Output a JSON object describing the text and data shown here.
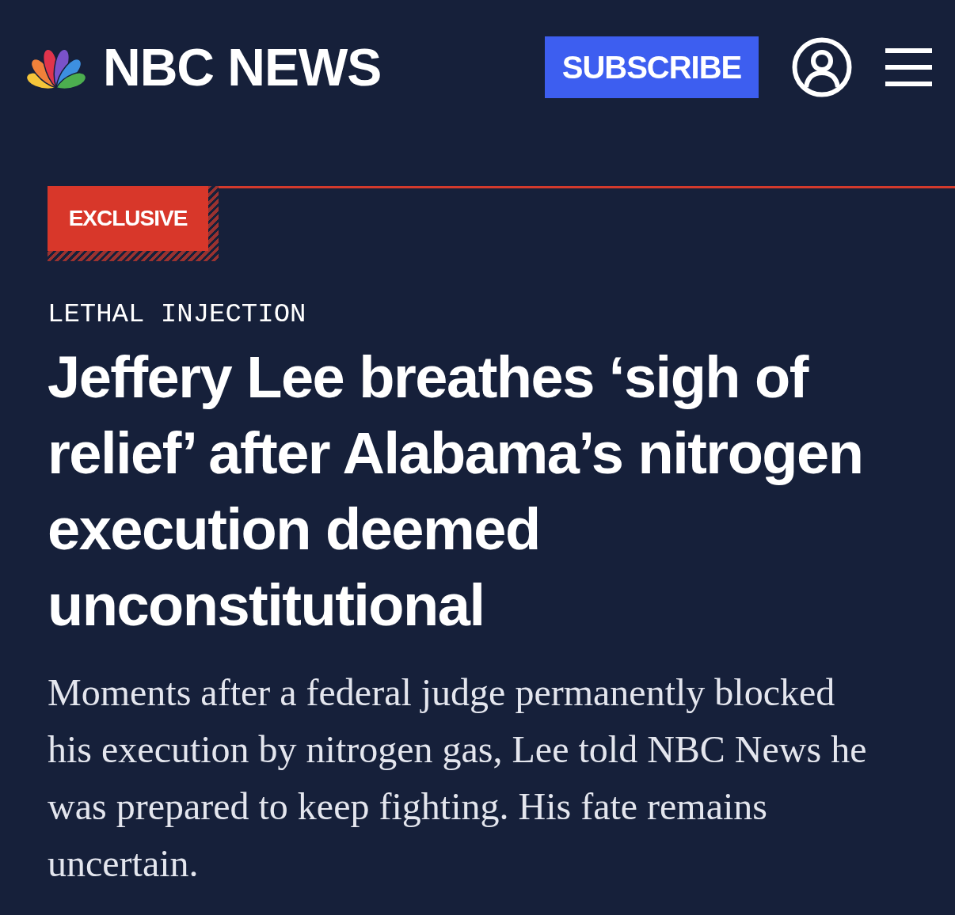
{
  "header": {
    "brand": "NBC NEWS",
    "subscribe_button": "SUBSCRIBE"
  },
  "article": {
    "badge": "EXCLUSIVE",
    "kicker": "LETHAL INJECTION",
    "headline": "Jeffery Lee breathes ‘sigh of relief’ after Alabama’s nitrogen execution deemed unconstitutional",
    "dek": "Moments after a federal judge permanently blocked his execution by nitrogen gas, Lee told NBC News he was prepared to keep fighting. His fate remains uncertain."
  }
}
